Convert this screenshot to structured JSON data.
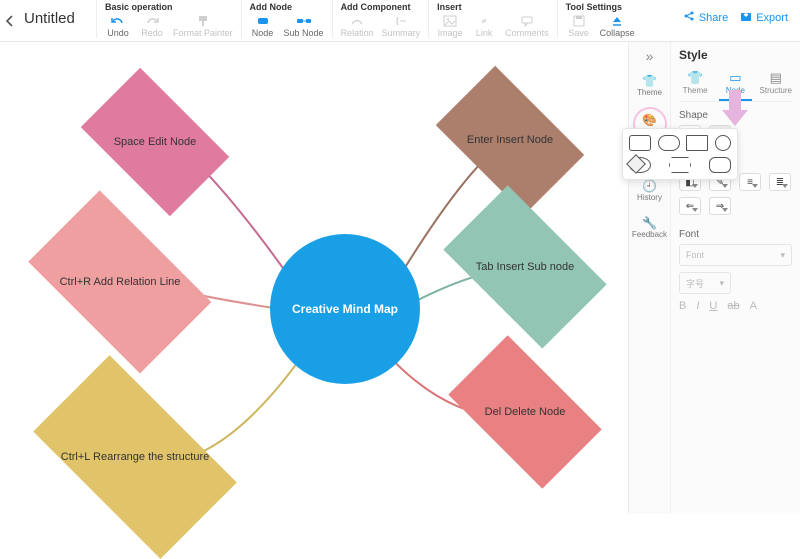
{
  "title": "Untitled",
  "toolbar": {
    "groups": [
      {
        "title": "Basic operation",
        "items": [
          {
            "key": "undo",
            "label": "Undo"
          },
          {
            "key": "redo",
            "label": "Redo"
          },
          {
            "key": "format",
            "label": "Format Painter"
          }
        ]
      },
      {
        "title": "Add Node",
        "items": [
          {
            "key": "node",
            "label": "Node"
          },
          {
            "key": "subnode",
            "label": "Sub Node"
          }
        ]
      },
      {
        "title": "Add Component",
        "items": [
          {
            "key": "relation",
            "label": "Relation"
          },
          {
            "key": "summary",
            "label": "Summary"
          }
        ]
      },
      {
        "title": "Insert",
        "items": [
          {
            "key": "image",
            "label": "Image"
          },
          {
            "key": "link",
            "label": "Link"
          },
          {
            "key": "comments",
            "label": "Comments"
          }
        ]
      },
      {
        "title": "Tool Settings",
        "items": [
          {
            "key": "save",
            "label": "Save"
          },
          {
            "key": "collapse",
            "label": "Collapse"
          }
        ]
      }
    ],
    "share": "Share",
    "export": "Export"
  },
  "mindmap": {
    "central": "Creative Mind Map",
    "nodes": {
      "tl": "Space Edit Node",
      "tr": "Enter Insert Node",
      "ml": "Ctrl+R Add Relation Line",
      "mr": "Tab Insert Sub node",
      "bl": "Ctrl+L Rearrange the structure",
      "br": "Del Delete Node"
    }
  },
  "rail": {
    "title": "Style",
    "icons": {
      "theme": "Theme",
      "style": "Style",
      "history": "History",
      "feedback": "Feedback"
    },
    "tabs": {
      "theme": "Theme",
      "node": "Node",
      "structure": "Structure"
    },
    "sections": {
      "shape": "Shape",
      "font": "Font"
    },
    "font_placeholder": "Font",
    "size_placeholder": "字号"
  }
}
